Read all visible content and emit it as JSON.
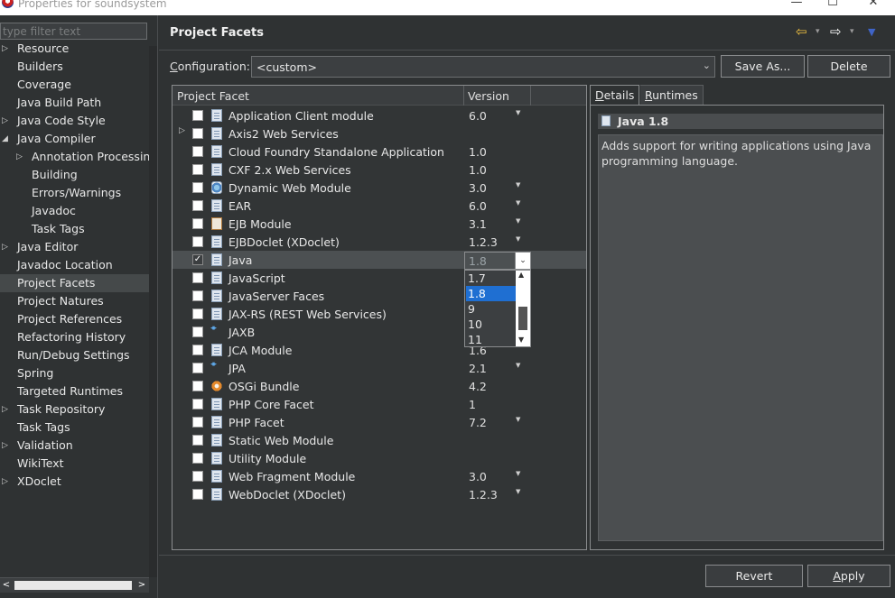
{
  "window": {
    "title": "Properties for soundsystem",
    "minimize": "—",
    "maximize": "☐",
    "close": "✕"
  },
  "sidebar": {
    "filter_placeholder": "type filter text",
    "items": [
      {
        "label": "Resource",
        "expander": "▷",
        "depth": 0
      },
      {
        "label": "Builders",
        "expander": "",
        "depth": 0
      },
      {
        "label": "Coverage",
        "expander": "",
        "depth": 0
      },
      {
        "label": "Java Build Path",
        "expander": "",
        "depth": 0
      },
      {
        "label": "Java Code Style",
        "expander": "▷",
        "depth": 0
      },
      {
        "label": "Java Compiler",
        "expander": "◢",
        "depth": 0
      },
      {
        "label": "Annotation Processing",
        "expander": "▷",
        "depth": 1
      },
      {
        "label": "Building",
        "expander": "",
        "depth": 1
      },
      {
        "label": "Errors/Warnings",
        "expander": "",
        "depth": 1
      },
      {
        "label": "Javadoc",
        "expander": "",
        "depth": 1
      },
      {
        "label": "Task Tags",
        "expander": "",
        "depth": 1
      },
      {
        "label": "Java Editor",
        "expander": "▷",
        "depth": 0
      },
      {
        "label": "Javadoc Location",
        "expander": "",
        "depth": 0
      },
      {
        "label": "Project Facets",
        "expander": "",
        "depth": 0,
        "selected": true
      },
      {
        "label": "Project Natures",
        "expander": "",
        "depth": 0
      },
      {
        "label": "Project References",
        "expander": "",
        "depth": 0
      },
      {
        "label": "Refactoring History",
        "expander": "",
        "depth": 0
      },
      {
        "label": "Run/Debug Settings",
        "expander": "",
        "depth": 0
      },
      {
        "label": "Spring",
        "expander": "",
        "depth": 0
      },
      {
        "label": "Targeted Runtimes",
        "expander": "",
        "depth": 0
      },
      {
        "label": "Task Repository",
        "expander": "▷",
        "depth": 0
      },
      {
        "label": "Task Tags",
        "expander": "",
        "depth": 0
      },
      {
        "label": "Validation",
        "expander": "▷",
        "depth": 0
      },
      {
        "label": "WikiText",
        "expander": "",
        "depth": 0
      },
      {
        "label": "XDoclet",
        "expander": "▷",
        "depth": 0
      }
    ],
    "scroll_left": "<",
    "scroll_right": ">"
  },
  "page": {
    "title": "Project Facets",
    "nav_back_icon": "⇦",
    "nav_forward_icon": "⇨",
    "nav_dropdown": "▾",
    "view_menu": "▼",
    "colors": {
      "back_arrow": "#f0c040",
      "forward_arrow": "#ffffff",
      "menu": "#3f64c8"
    }
  },
  "configuration": {
    "label_prefix": "C",
    "label_rest": "onfiguration:",
    "value": "<custom>",
    "chevron": "⌄",
    "save_as": "Save As...",
    "delete": "Delete"
  },
  "facets": {
    "col_facet": "Project Facet",
    "col_version": "Version",
    "rows": [
      {
        "name": "Application Client module",
        "version": "6.0",
        "checked": false,
        "dropdown": true,
        "icon": "doc"
      },
      {
        "name": "Axis2 Web Services",
        "version": "",
        "checked": false,
        "dropdown": false,
        "icon": "doc",
        "expander": "▷"
      },
      {
        "name": "Cloud Foundry Standalone Application",
        "version": "1.0",
        "checked": false,
        "dropdown": false,
        "icon": "doc"
      },
      {
        "name": "CXF 2.x Web Services",
        "version": "1.0",
        "checked": false,
        "dropdown": false,
        "icon": "doc"
      },
      {
        "name": "Dynamic Web Module",
        "version": "3.0",
        "checked": false,
        "dropdown": true,
        "icon": "globe"
      },
      {
        "name": "EAR",
        "version": "6.0",
        "checked": false,
        "dropdown": true,
        "icon": "doc"
      },
      {
        "name": "EJB Module",
        "version": "3.1",
        "checked": false,
        "dropdown": true,
        "icon": "ejb"
      },
      {
        "name": "EJBDoclet (XDoclet)",
        "version": "1.2.3",
        "checked": false,
        "dropdown": true,
        "icon": "doc"
      },
      {
        "name": "Java",
        "version": "1.8",
        "checked": true,
        "dropdown": false,
        "icon": "doc",
        "selected": true
      },
      {
        "name": "JavaScript",
        "version": "",
        "checked": false,
        "dropdown": false,
        "icon": "doc"
      },
      {
        "name": "JavaServer Faces",
        "version": "",
        "checked": false,
        "dropdown": false,
        "icon": "doc"
      },
      {
        "name": "JAX-RS (REST Web Services)",
        "version": "",
        "checked": false,
        "dropdown": false,
        "icon": "doc"
      },
      {
        "name": "JAXB",
        "version": "",
        "checked": false,
        "dropdown": false,
        "icon": "diamond"
      },
      {
        "name": "JCA Module",
        "version": "1.6",
        "checked": false,
        "dropdown": false,
        "icon": "doc"
      },
      {
        "name": "JPA",
        "version": "2.1",
        "checked": false,
        "dropdown": true,
        "icon": "diamond"
      },
      {
        "name": "OSGi Bundle",
        "version": "4.2",
        "checked": false,
        "dropdown": false,
        "icon": "gear"
      },
      {
        "name": "PHP Core Facet",
        "version": "1",
        "checked": false,
        "dropdown": false,
        "icon": "doc"
      },
      {
        "name": "PHP Facet",
        "version": "7.2",
        "checked": false,
        "dropdown": true,
        "icon": "doc"
      },
      {
        "name": "Static Web Module",
        "version": "",
        "checked": false,
        "dropdown": false,
        "icon": "doc"
      },
      {
        "name": "Utility Module",
        "version": "",
        "checked": false,
        "dropdown": false,
        "icon": "doc"
      },
      {
        "name": "Web Fragment Module",
        "version": "3.0",
        "checked": false,
        "dropdown": true,
        "icon": "doc"
      },
      {
        "name": "WebDoclet (XDoclet)",
        "version": "1.2.3",
        "checked": false,
        "dropdown": true,
        "icon": "doc"
      }
    ],
    "dropdown_glyph": "▼",
    "checkmark": "✓"
  },
  "version_combo": {
    "value": "1.8",
    "arrow": "⌄",
    "options": [
      "1.7",
      "1.8",
      "9",
      "10",
      "11"
    ],
    "highlighted": "1.8",
    "scroll_up": "▲",
    "scroll_down": "▼"
  },
  "details": {
    "tab_details_prefix": "D",
    "tab_details_rest": "etails",
    "tab_runtimes_prefix": "R",
    "tab_runtimes_rest": "untimes",
    "selected_title": "Java 1.8",
    "description": "Adds support for writing applications using Java programming language."
  },
  "buttons": {
    "revert": "Revert",
    "apply_prefix": "A",
    "apply_rest": "pply"
  }
}
